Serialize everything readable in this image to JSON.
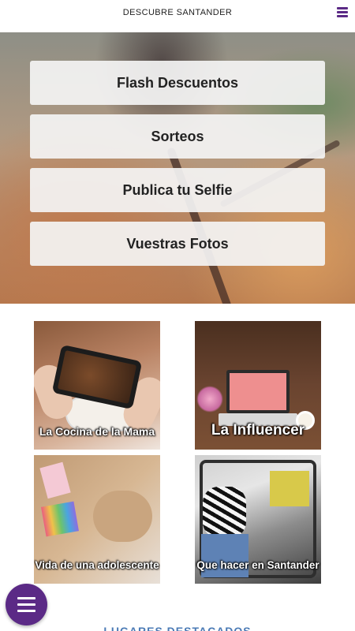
{
  "header": {
    "title": "DESCUBRE SANTANDER",
    "menu_icon": "hamburger-menu-icon",
    "accent_color": "#5b2a86"
  },
  "hero": {
    "buttons": [
      {
        "label": "Flash Descuentos"
      },
      {
        "label": "Sorteos"
      },
      {
        "label": "Publica tu Selfie"
      },
      {
        "label": "Vuestras Fotos"
      }
    ]
  },
  "tiles": [
    {
      "caption": "La Cocina de la Mama"
    },
    {
      "caption": "La Influencer"
    },
    {
      "caption": "Vida de una adolescente"
    },
    {
      "caption": "Que hacer en Santander"
    }
  ],
  "footer": {
    "section_title": "LUGARES DESTACADOS",
    "fab_icon": "hamburger-menu-icon"
  }
}
